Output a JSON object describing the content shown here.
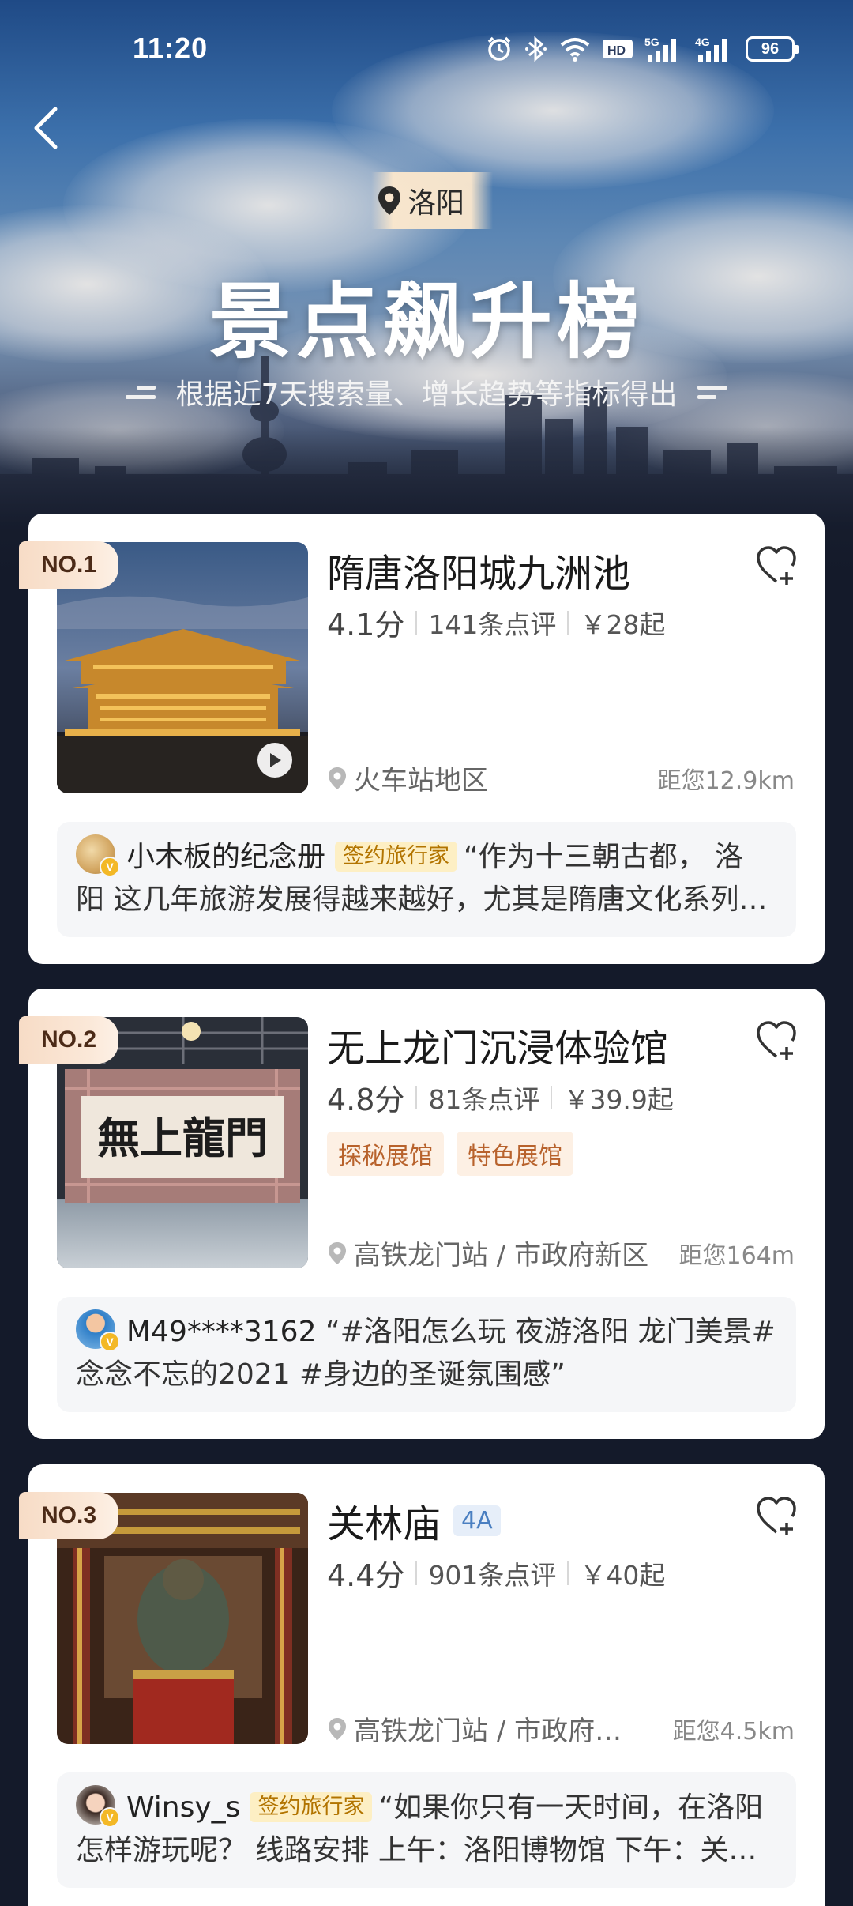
{
  "status_bar": {
    "time": "11:20",
    "battery": "96",
    "icons": [
      "alarm-icon",
      "bluetooth-icon",
      "wifi-icon",
      "hd-icon",
      "signal-5g-icon",
      "signal-4g-icon",
      "battery-icon"
    ]
  },
  "header": {
    "location": "洛阳",
    "title": "景点飙升榜",
    "subtitle": "根据近7天搜索量、增长趋势等指标得出"
  },
  "attractions": [
    {
      "rank": "NO.1",
      "name": "隋唐洛阳城九洲池",
      "level": "",
      "score": "4.1分",
      "reviews": "141条点评",
      "price": "￥28起",
      "tags": [],
      "area": "火车站地区",
      "distance": "距您12.9km",
      "has_video": true,
      "review": {
        "author": "小木板的纪念册",
        "badge": "签约旅行家",
        "line1": "“作为十三朝古都， 洛",
        "line2": "阳 这几年旅游发展得越来越好，尤其是隋唐文化系列…"
      }
    },
    {
      "rank": "NO.2",
      "name": "无上龙门沉浸体验馆",
      "level": "",
      "score": "4.8分",
      "reviews": "81条点评",
      "price": "￥39.9起",
      "tags": [
        "探秘展馆",
        "特色展馆"
      ],
      "area": "高铁龙门站 / 市政府新区",
      "distance": "距您164m",
      "has_video": false,
      "thumb_sign": "無上龍門",
      "review": {
        "author": "M49****3162",
        "badge": "",
        "line1": "“#洛阳怎么玩 夜游洛阳 龙门美景#",
        "line2": "念念不忘的2021 #身边的圣诞氛围感”"
      }
    },
    {
      "rank": "NO.3",
      "name": "关林庙",
      "level": "4A",
      "score": "4.4分",
      "reviews": "901条点评",
      "price": "￥40起",
      "tags": [],
      "area": "高铁龙门站 / 市政府…",
      "distance": "距您4.5km",
      "has_video": false,
      "review": {
        "author": "Winsy_s",
        "badge": "签约旅行家",
        "line1": "“如果你只有一天时间，在洛阳",
        "line2": "怎样游玩呢？ 线路安排 上午：洛阳博物馆 下午：关…"
      }
    }
  ],
  "colors": {
    "rank_badge": "#f7dcc6",
    "traveler_badge_bg": "#fdefc4",
    "traveler_badge_text": "#b27400",
    "tag_text": "#b8622c",
    "level_tag_text": "#4a7fc1"
  }
}
